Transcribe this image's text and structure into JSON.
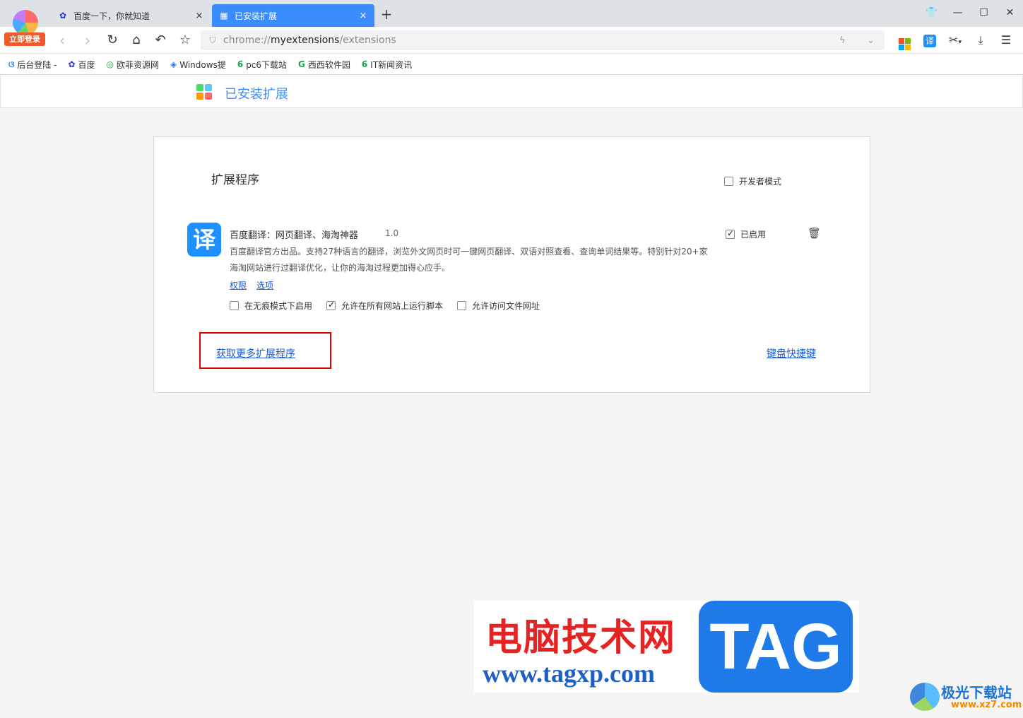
{
  "app": {
    "login_badge": "立即登录"
  },
  "tabs": [
    {
      "title": "百度一下，你就知道",
      "icon": "baidu-paw-icon",
      "active": false
    },
    {
      "title": "已安装扩展",
      "icon": "extensions-page-icon",
      "active": true
    }
  ],
  "toolbar": {
    "url_prefix": "chrome://",
    "url_host": "myextensions",
    "url_path": "/extensions"
  },
  "bookmarks": [
    {
      "label": "后台登陆 -",
      "icon": "backend-icon",
      "color": "#2a7ae2"
    },
    {
      "label": "百度",
      "icon": "baidu-paw-icon",
      "color": "#2932e1"
    },
    {
      "label": "欧菲资源网",
      "icon": "oufei-icon",
      "color": "#1aa34a"
    },
    {
      "label": "Windows提",
      "icon": "windows-icon",
      "color": "#2a7ae2"
    },
    {
      "label": "pc6下载站",
      "icon": "pc6-icon",
      "color": "#1aa34a"
    },
    {
      "label": "西西软件园",
      "icon": "xixi-icon",
      "color": "#1aa34a"
    },
    {
      "label": "IT新闻资讯",
      "icon": "pc6-icon",
      "color": "#1aa34a"
    }
  ],
  "page_header": {
    "title": "已安装扩展"
  },
  "card": {
    "title": "扩展程序",
    "developer_mode_label": "开发者模式",
    "developer_mode_checked": false,
    "extension": {
      "icon_glyph": "译",
      "name": "百度翻译：网页翻译、海淘神器",
      "version": "1.0",
      "description": "百度翻译官方出品。支持27种语言的翻译，浏览外文网页时可一键网页翻译、双语对照查看、查询单词结果等。特别针对20+家海淘网站进行过翻译优化，让你的海淘过程更加得心应手。",
      "link_permissions": "权限",
      "link_options": "选项",
      "enabled_label": "已启用",
      "enabled_checked": true,
      "options": [
        {
          "label": "在无痕模式下启用",
          "checked": false
        },
        {
          "label": "允许在所有网站上运行脚本",
          "checked": true
        },
        {
          "label": "允许访问文件网址",
          "checked": false
        }
      ]
    },
    "get_more_link": "获取更多扩展程序",
    "shortcuts_link": "键盘快捷键"
  },
  "watermark": {
    "cn_text": "电脑技术网",
    "url": "www.tagxp.com",
    "badge": "TAG",
    "site_name": "极光下载站",
    "site_url": "www.xz7.com"
  },
  "colors": {
    "accent": "#3b8cff",
    "highlight_box": "#e00000",
    "link": "#1a5ad6"
  }
}
